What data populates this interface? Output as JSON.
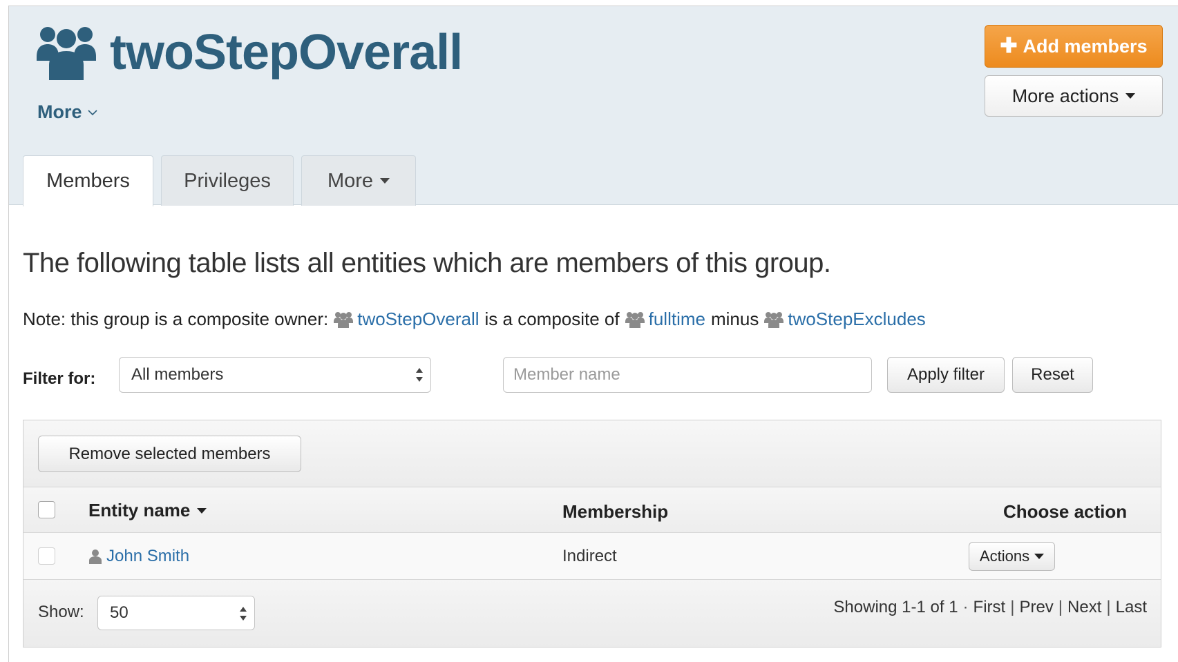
{
  "header": {
    "title": "twoStepOverall",
    "more_label": "More",
    "add_members_label": "Add members",
    "more_actions_label": "More actions"
  },
  "tabs": [
    {
      "label": "Members"
    },
    {
      "label": "Privileges"
    },
    {
      "label": "More"
    }
  ],
  "main": {
    "lead": "The following table lists all entities which are members of this group.",
    "note": {
      "prefix": "Note: this group is a composite owner:",
      "owner": "twoStepOverall",
      "middle": "is a composite of",
      "left_factor": "fulltime",
      "operator": "minus",
      "right_factor": "twoStepExcludes"
    },
    "filter": {
      "label": "Filter for:",
      "select_value": "All members",
      "name_placeholder": "Member name",
      "apply_label": "Apply filter",
      "reset_label": "Reset"
    },
    "table": {
      "remove_label": "Remove selected members",
      "columns": [
        "Entity name",
        "Membership",
        "Choose action"
      ],
      "rows": [
        {
          "name": "John Smith",
          "membership": "Indirect",
          "action_label": "Actions"
        }
      ]
    },
    "footer": {
      "show_label": "Show:",
      "page_size": "50",
      "showing": "Showing 1-1 of 1",
      "dot": "·",
      "first": "First",
      "prev": "Prev",
      "next": "Next",
      "last": "Last",
      "divider": "|"
    }
  },
  "icons": {
    "group": "group-icon",
    "person": "person-icon",
    "caret": "caret-down-icon"
  },
  "colors": {
    "title": "#2e5f7c",
    "link": "#2a6ea8",
    "accent_orange": "#ed8b1e",
    "header_bg": "#e6edf2"
  }
}
